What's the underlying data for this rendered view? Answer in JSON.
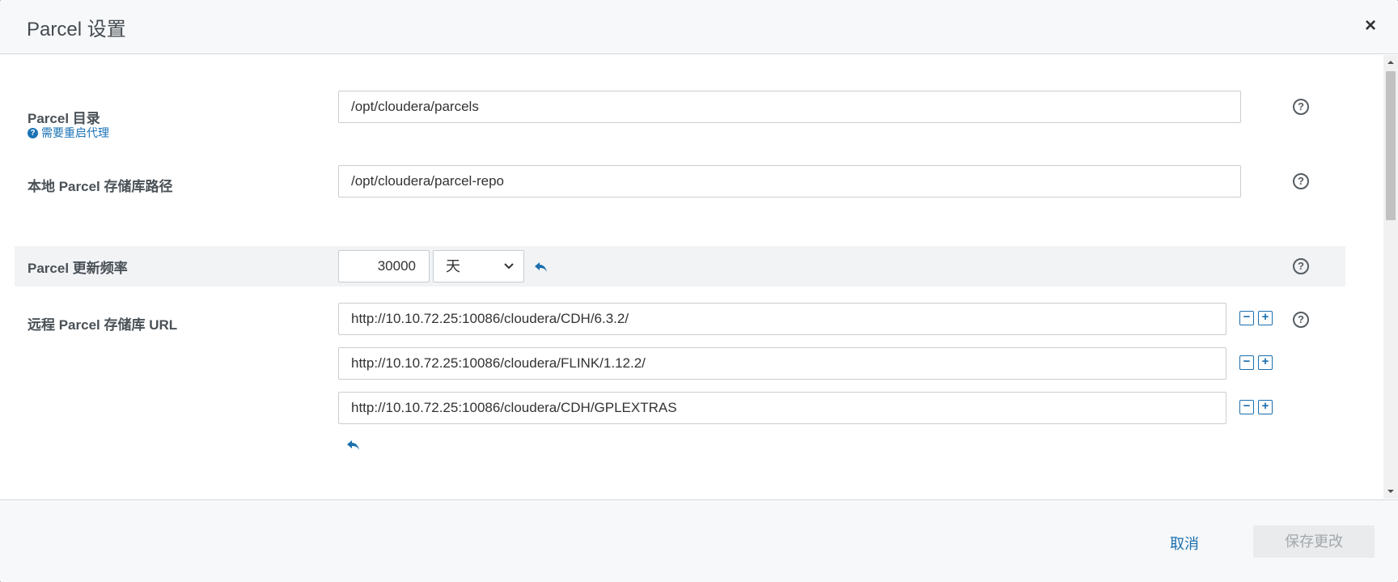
{
  "dialog": {
    "title": "Parcel 设置",
    "close_label": "×"
  },
  "fields": {
    "parcel_dir": {
      "label": "Parcel 目录",
      "note": "需要重启代理",
      "value": "/opt/cloudera/parcels"
    },
    "local_repo_path": {
      "label": "本地 Parcel 存储库路径",
      "value": "/opt/cloudera/parcel-repo"
    },
    "update_frequency": {
      "label": "Parcel 更新频率",
      "value": "30000",
      "unit": "天"
    },
    "remote_repo_urls": {
      "label": "远程 Parcel 存储库 URL",
      "urls": [
        "http://10.10.72.25:10086/cloudera/CDH/6.3.2/",
        "http://10.10.72.25:10086/cloudera/FLINK/1.12.2/",
        "http://10.10.72.25:10086/cloudera/CDH/GPLEXTRAS"
      ]
    }
  },
  "footer": {
    "cancel_label": "取消",
    "save_label": "保存更改"
  },
  "icons": {
    "help": "?",
    "minus": "−",
    "plus": "+",
    "chevron": "⌄"
  },
  "colors": {
    "link_blue": "#1a6fae",
    "label_text": "#4a5157",
    "highlight_row": "#f1f3f5"
  }
}
